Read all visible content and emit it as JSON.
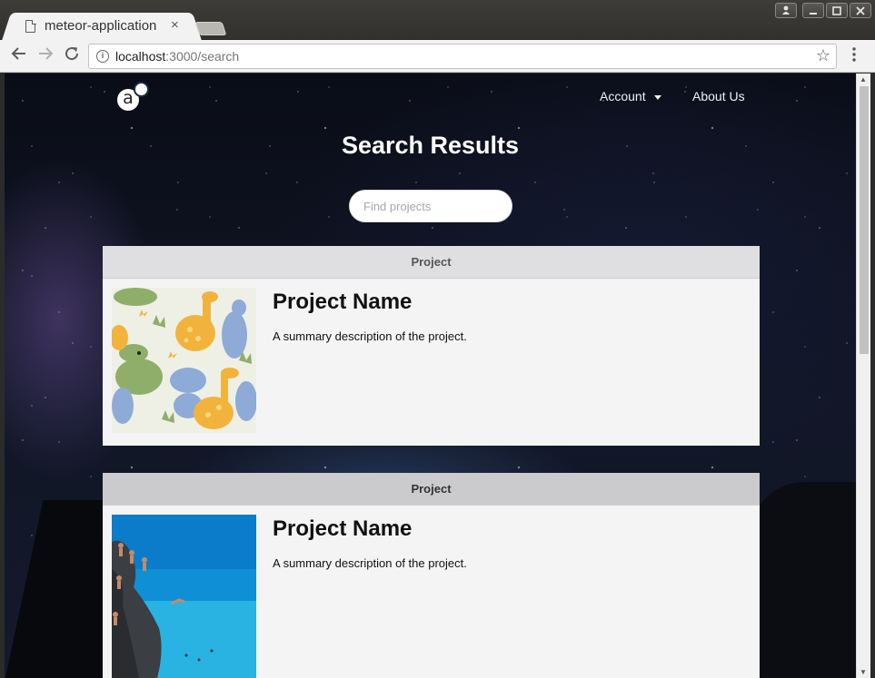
{
  "browser": {
    "tab_title": "meteor-application",
    "tab_close": "×",
    "url_host": "localhost",
    "url_path": ":3000/search",
    "back_icon": "arrow-left-icon",
    "forward_icon": "arrow-right-icon",
    "reload_icon": "reload-icon",
    "info_icon": "info-icon",
    "star_icon": "star-icon",
    "menu_icon": "kebab-menu-icon",
    "window_controls": [
      "user-icon",
      "minimize-icon",
      "maximize-icon",
      "close-icon"
    ]
  },
  "header": {
    "logo_letter": "a",
    "nav": {
      "account": "Account",
      "about": "About Us"
    }
  },
  "page": {
    "title": "Search Results",
    "search_placeholder": "Find projects"
  },
  "projects": [
    {
      "header": "Project",
      "name": "Project Name",
      "description": "A summary description of the project.",
      "image": "dinosaur-pattern-image"
    },
    {
      "header": "Project",
      "name": "Project Name",
      "description": "A summary description of the project.",
      "image": "cliff-diving-sea-image"
    }
  ],
  "colors": {
    "card_bg": "#f4f4f4",
    "card_header": "#dfdfe1",
    "accent_white": "#ffffff"
  }
}
